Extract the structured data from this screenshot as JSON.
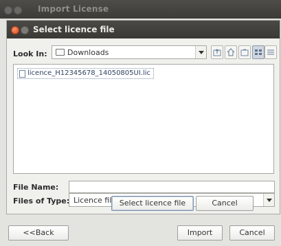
{
  "outer_window": {
    "title": "Import License",
    "back_button": "<<Back",
    "import_button": "Import",
    "cancel_button": "Cancel"
  },
  "dialog": {
    "title": "Select licence file",
    "look_in_label": "Look In:",
    "look_in_value": "Downloads",
    "toolbar": [
      "up-folder-icon",
      "home-icon",
      "new-folder-icon",
      "list-view-icon",
      "details-view-icon"
    ],
    "files": [
      "licence_H12345678_14050805UI.lic"
    ],
    "file_name_label": "File Name:",
    "file_name_value": "",
    "files_of_type_label": "Files of Type:",
    "files_of_type_value": "Licence files (*.lic)",
    "select_button": "Select licence file",
    "cancel_button": "Cancel"
  }
}
